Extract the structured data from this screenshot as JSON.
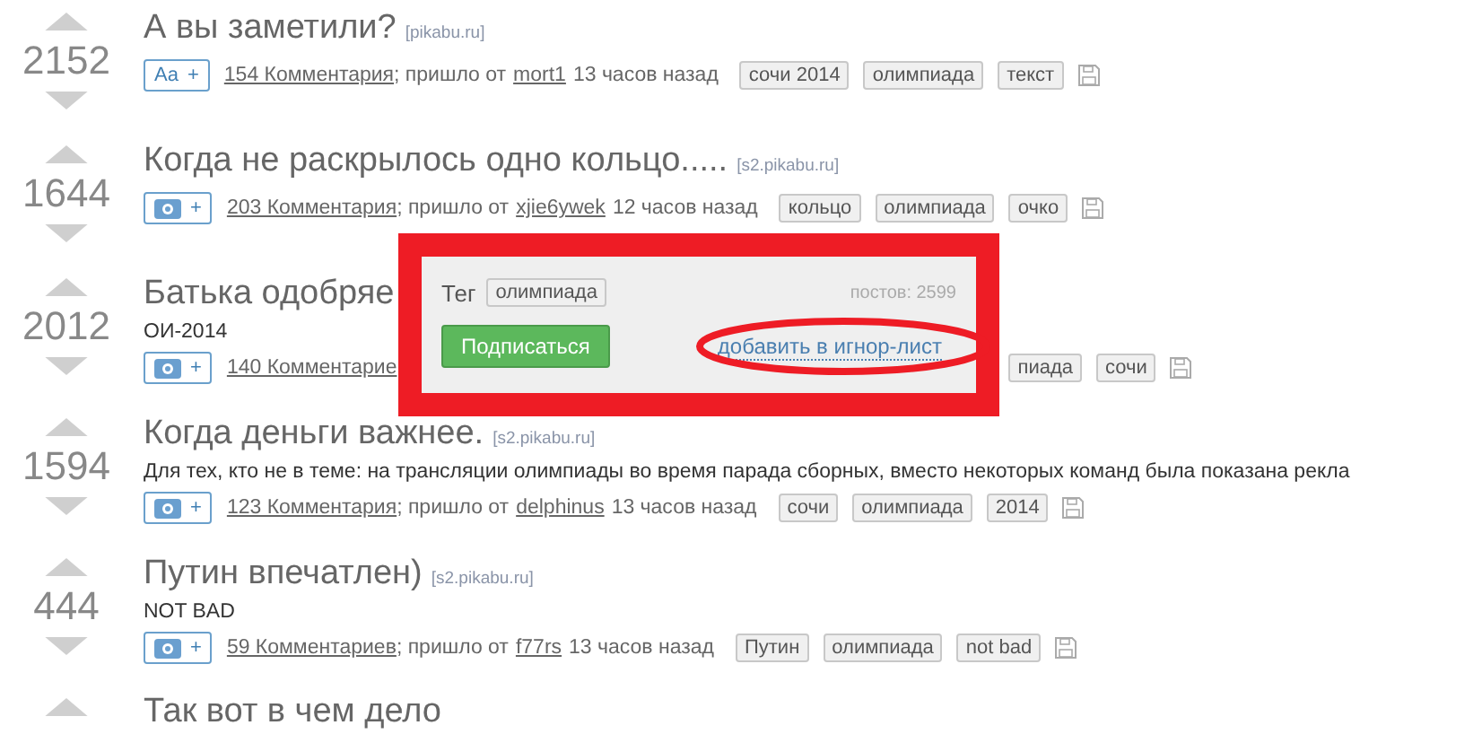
{
  "posts": [
    {
      "score": "2152",
      "title": "А вы заметили?",
      "source": "[pikabu.ru]",
      "badge": {
        "kind": "text",
        "label": "Aa",
        "plus": "+"
      },
      "comments": "154 Комментария",
      "from_label": "; пришло от",
      "author": "mort1",
      "time": "13 часов назад",
      "tags": [
        "сочи 2014",
        "олимпиада",
        "текст"
      ]
    },
    {
      "score": "1644",
      "title": "Когда не раскрылось одно кольцо.....",
      "source": "[s2.pikabu.ru]",
      "badge": {
        "kind": "photo",
        "plus": "+"
      },
      "comments": "203 Комментария",
      "from_label": "; пришло от",
      "author": "xjie6ywek",
      "time": "12 часов назад",
      "tags": [
        "кольцо",
        "олимпиада",
        "очко"
      ]
    },
    {
      "score": "2012",
      "title": "Батька одобряе",
      "description": "ОИ-2014",
      "badge": {
        "kind": "photo",
        "plus": "+"
      },
      "comments": "140 Комментарие",
      "tags": [
        "пиада",
        "сочи"
      ],
      "tag_popup": {
        "label": "Тег",
        "tag": "олимпиада",
        "count": "постов: 2599",
        "subscribe": "Подписаться",
        "ignore_link": "добавить в игнор-лист"
      }
    },
    {
      "score": "1594",
      "title": "Когда деньги важнее.",
      "source": "[s2.pikabu.ru]",
      "description": "Для тех, кто не в теме: на трансляции олимпиады во время парада сборных, вместо некоторых команд была показана рекла",
      "badge": {
        "kind": "photo",
        "plus": "+"
      },
      "comments": "123 Комментария",
      "from_label": "; пришло от",
      "author": "delphinus",
      "time": "13 часов назад",
      "tags": [
        "сочи",
        "олимпиада",
        "2014"
      ]
    },
    {
      "score": "444",
      "title": "Путин впечатлен)",
      "source": "[s2.pikabu.ru]",
      "description": "NOT BAD",
      "badge": {
        "kind": "photo",
        "plus": "+"
      },
      "comments": "59 Комментариев",
      "from_label": "; пришло от",
      "author": "f77rs",
      "time": "13 часов назад",
      "tags": [
        "Путин",
        "олимпиада",
        "not bad"
      ]
    },
    {
      "title": "Так вот в чем дело"
    }
  ]
}
